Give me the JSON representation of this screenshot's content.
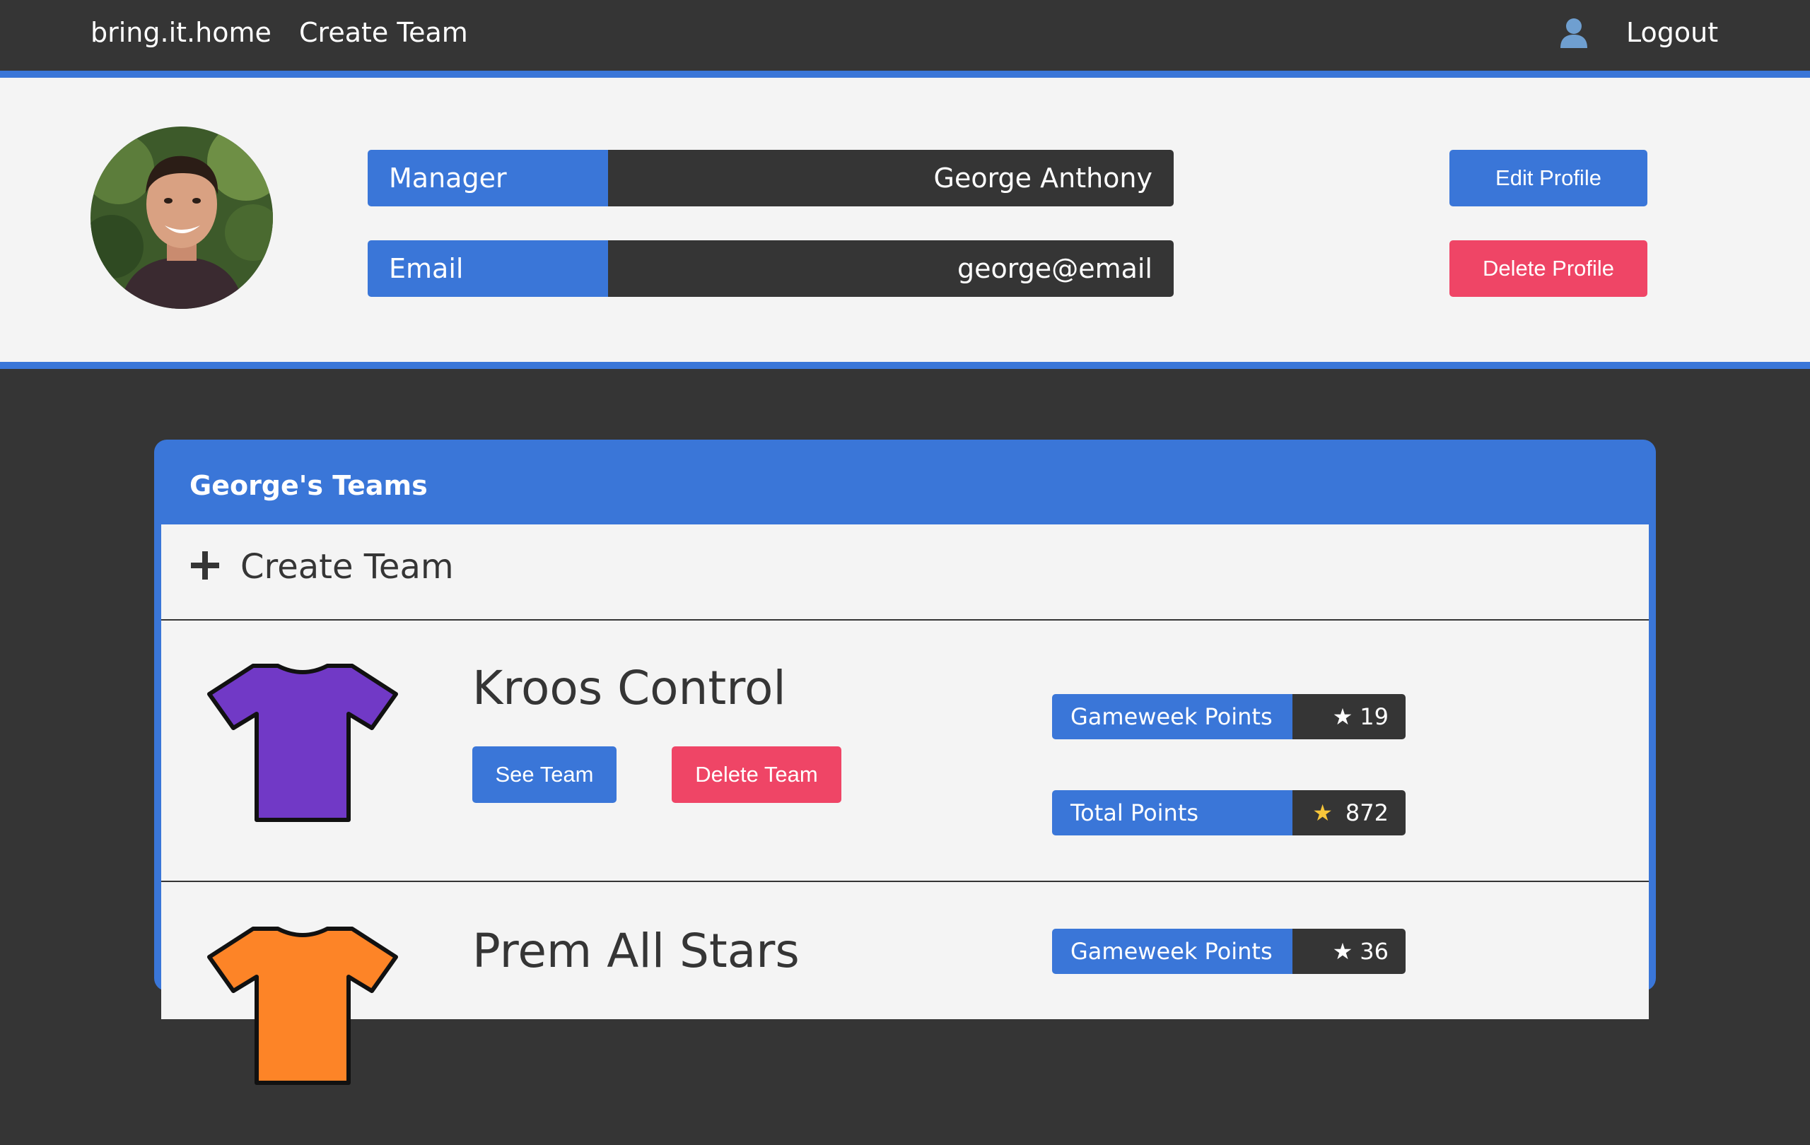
{
  "nav": {
    "brand": "bring.it.home",
    "create_team": "Create Team",
    "user_icon": "user-icon",
    "logout": "Logout"
  },
  "profile": {
    "manager_label": "Manager",
    "manager_value": "George Anthony",
    "email_label": "Email",
    "email_value": "george@email",
    "edit_button": "Edit Profile",
    "delete_button": "Delete Profile"
  },
  "teams": {
    "title": "George's Teams",
    "create_label": "Create Team",
    "items": [
      {
        "name": "Kroos Control",
        "shirt_color": "#7139c6",
        "see_button": "See Team",
        "delete_button": "Delete Team",
        "gameweek_label": "Gameweek Points",
        "gameweek_points": "19",
        "total_label": "Total Points",
        "total_points": "872"
      },
      {
        "name": "Prem All Stars",
        "shirt_color": "#fd8427",
        "gameweek_label": "Gameweek Points",
        "gameweek_points": "36"
      }
    ]
  },
  "colors": {
    "accent_blue": "#3a76d8",
    "danger_red": "#ef4566",
    "dark": "#353535",
    "light": "#f4f4f4"
  }
}
